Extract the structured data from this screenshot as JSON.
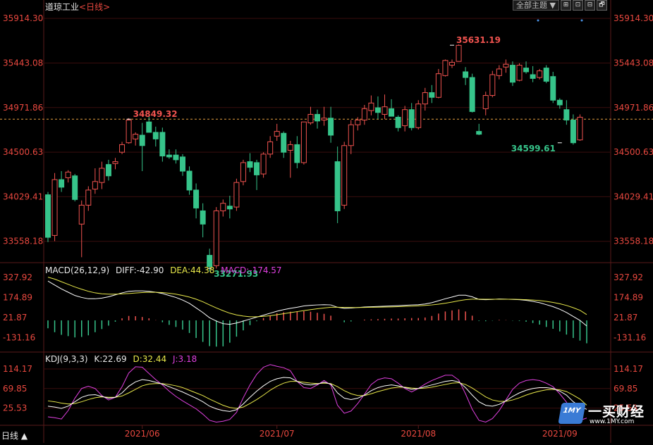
{
  "header": {
    "title": "道琼工业",
    "period": "<日线>"
  },
  "toolbar": {
    "theme_select": "全部主题",
    "theme_arrow": "▼",
    "btn1": "⊞",
    "btn2": "⊡",
    "btn3": "⊟",
    "btn4": "🗗"
  },
  "bottom_tab": "日线 ▲",
  "watermark": {
    "brand": "一买财经",
    "url": "www.1MY.com",
    "mark": "1MY"
  },
  "colors": {
    "up": "#f0534f",
    "down": "#36c48a",
    "bg": "#000000",
    "grid": "#3a0d0d",
    "axis_text": "#e9483f",
    "diff": "#ffffff",
    "dea": "#e8e84a",
    "macd_title": "#e040e0",
    "k": "#ffffff",
    "d": "#e8e84a",
    "j": "#e040e0",
    "ref": "#e6a040"
  },
  "chart_data": [
    {
      "type": "candlestick",
      "name": "price",
      "y_ticks": [
        "35914.30",
        "35443.08",
        "34971.86",
        "34500.63",
        "34029.41",
        "33558.18"
      ],
      "ylim": [
        33340,
        35990
      ],
      "reference_line": 34849.32,
      "annotations": [
        {
          "label": "35631.19",
          "value": 35631.19,
          "index": 60,
          "color": "up"
        },
        {
          "label": "34849.32",
          "value": 34849.32,
          "index": 12,
          "color": "up"
        },
        {
          "label": "33271.93",
          "value": 33271.93,
          "index": 24,
          "color": "down"
        },
        {
          "label": "34599.61",
          "value": 34599.61,
          "index": 76,
          "color": "down"
        }
      ],
      "x_labels": [
        {
          "label": "2021/06",
          "index": 14
        },
        {
          "label": "2021/07",
          "index": 34
        },
        {
          "label": "2021/08",
          "index": 55
        },
        {
          "label": "2021/09",
          "index": 76
        }
      ],
      "ohlc": [
        [
          34050,
          34080,
          33550,
          33600
        ],
        [
          33620,
          34280,
          33560,
          34210
        ],
        [
          34210,
          34300,
          34080,
          34130
        ],
        [
          34230,
          34310,
          34180,
          34290
        ],
        [
          34250,
          34270,
          33980,
          34000
        ],
        [
          33740,
          33990,
          33390,
          33940
        ],
        [
          33940,
          34140,
          33880,
          34100
        ],
        [
          34110,
          34330,
          34060,
          34190
        ],
        [
          34180,
          34400,
          34110,
          34330
        ],
        [
          34370,
          34420,
          34200,
          34250
        ],
        [
          34380,
          34440,
          34320,
          34400
        ],
        [
          34500,
          34610,
          34480,
          34580
        ],
        [
          34600,
          34860,
          34590,
          34840
        ],
        [
          34640,
          34710,
          34570,
          34690
        ],
        [
          34680,
          34810,
          34300,
          34570
        ],
        [
          34820,
          34890,
          34780,
          34710
        ],
        [
          34710,
          34770,
          34560,
          34640
        ],
        [
          34710,
          34760,
          34400,
          34460
        ],
        [
          34470,
          34530,
          34430,
          34450
        ],
        [
          34470,
          34530,
          34380,
          34420
        ],
        [
          34450,
          34480,
          34250,
          34300
        ],
        [
          34300,
          34350,
          34050,
          34100
        ],
        [
          34100,
          34170,
          33800,
          33910
        ],
        [
          33880,
          33960,
          33600,
          33740
        ],
        [
          33410,
          33480,
          33240,
          33290
        ],
        [
          33300,
          33920,
          33270,
          33880
        ],
        [
          33880,
          34000,
          33820,
          33960
        ],
        [
          33930,
          34040,
          33800,
          33900
        ],
        [
          33920,
          34220,
          33880,
          34180
        ],
        [
          34190,
          34420,
          34150,
          34390
        ],
        [
          34400,
          34490,
          34290,
          34340
        ],
        [
          34390,
          34420,
          34100,
          34260
        ],
        [
          34270,
          34500,
          34230,
          34480
        ],
        [
          34480,
          34670,
          34440,
          34610
        ],
        [
          34670,
          34800,
          34620,
          34720
        ],
        [
          34700,
          34720,
          34440,
          34500
        ],
        [
          34520,
          34620,
          34230,
          34580
        ],
        [
          34580,
          34670,
          34330,
          34390
        ],
        [
          34390,
          34810,
          34370,
          34820
        ],
        [
          34810,
          34980,
          34790,
          34900
        ],
        [
          34900,
          34950,
          34750,
          34830
        ],
        [
          34840,
          34980,
          34780,
          34860
        ],
        [
          34860,
          34980,
          34600,
          34680
        ],
        [
          34400,
          34560,
          33750,
          33880
        ],
        [
          33940,
          34610,
          33900,
          34570
        ],
        [
          34570,
          34840,
          34480,
          34790
        ],
        [
          34790,
          34870,
          34730,
          34840
        ],
        [
          34840,
          35000,
          34790,
          34960
        ],
        [
          34940,
          35100,
          34890,
          35020
        ],
        [
          34970,
          35090,
          34850,
          34920
        ],
        [
          34900,
          35110,
          34850,
          34980
        ],
        [
          34960,
          35060,
          34880,
          34880
        ],
        [
          34870,
          34890,
          34720,
          34760
        ],
        [
          34780,
          34990,
          34720,
          34950
        ],
        [
          34950,
          35020,
          34730,
          34760
        ],
        [
          34760,
          35050,
          34740,
          35010
        ],
        [
          35010,
          35180,
          34940,
          35130
        ],
        [
          35130,
          35210,
          35020,
          35080
        ],
        [
          35080,
          35380,
          35070,
          35330
        ],
        [
          35310,
          35480,
          35300,
          35470
        ],
        [
          35420,
          35480,
          35390,
          35450
        ],
        [
          35460,
          35640,
          35460,
          35630
        ],
        [
          35350,
          35400,
          35210,
          35290
        ],
        [
          35290,
          35330,
          34920,
          34930
        ],
        [
          34720,
          34800,
          34680,
          34690
        ],
        [
          34960,
          35140,
          34890,
          35100
        ],
        [
          35100,
          35360,
          35080,
          35320
        ],
        [
          35310,
          35420,
          35270,
          35380
        ],
        [
          35400,
          35480,
          35340,
          35430
        ],
        [
          35420,
          35460,
          35200,
          35240
        ],
        [
          35260,
          35440,
          35250,
          35420
        ],
        [
          35390,
          35460,
          35330,
          35350
        ],
        [
          35320,
          35410,
          35240,
          35280
        ],
        [
          35290,
          35380,
          35270,
          35360
        ],
        [
          35390,
          35420,
          35230,
          35250
        ],
        [
          35300,
          35350,
          35020,
          35050
        ],
        [
          35050,
          35070,
          34960,
          35000
        ],
        [
          34950,
          35050,
          34790,
          34840
        ],
        [
          34840,
          34900,
          34580,
          34600
        ],
        [
          34630,
          34900,
          34620,
          34870
        ]
      ]
    },
    {
      "type": "line+bar",
      "name": "MACD",
      "title": "MACD(26,12,9)",
      "legend": [
        {
          "label": "DIFF:-42.90",
          "color": "diff"
        },
        {
          "label": "DEA:44.38",
          "color": "dea"
        },
        {
          "label": "MACD:-174.57",
          "color": "macd_title"
        }
      ],
      "y_ticks": [
        "327.92",
        "174.89",
        "21.87",
        "-131.16"
      ],
      "ylim": [
        -220,
        360
      ],
      "diff": [
        300,
        270,
        240,
        215,
        190,
        175,
        165,
        165,
        170,
        180,
        195,
        210,
        222,
        225,
        225,
        222,
        215,
        205,
        190,
        175,
        155,
        130,
        95,
        60,
        20,
        -5,
        -25,
        -30,
        -20,
        -5,
        10,
        25,
        40,
        55,
        70,
        82,
        92,
        100,
        110,
        115,
        118,
        120,
        118,
        100,
        92,
        94,
        98,
        102,
        104,
        106,
        108,
        110,
        112,
        115,
        118,
        120,
        125,
        135,
        150,
        165,
        178,
        192,
        192,
        180,
        160,
        158,
        160,
        163,
        162,
        160,
        158,
        153,
        145,
        135,
        120,
        105,
        85,
        60,
        30,
        0,
        -42.9
      ],
      "dea": [
        330,
        315,
        295,
        275,
        255,
        238,
        222,
        210,
        203,
        200,
        200,
        202,
        205,
        209,
        212,
        214,
        214,
        212,
        207,
        200,
        190,
        178,
        162,
        142,
        118,
        95,
        74,
        55,
        42,
        33,
        28,
        28,
        31,
        36,
        43,
        51,
        59,
        67,
        75,
        82,
        89,
        95,
        100,
        100,
        99,
        98,
        98,
        99,
        100,
        101,
        102,
        103,
        105,
        107,
        109,
        111,
        114,
        118,
        124,
        131,
        140,
        150,
        158,
        162,
        162,
        161,
        161,
        161,
        161,
        161,
        160,
        158,
        155,
        151,
        145,
        137,
        127,
        114,
        97,
        77,
        44.38
      ],
      "macd": [
        -60,
        -90,
        -110,
        -120,
        -130,
        -126,
        -114,
        -90,
        -66,
        -40,
        -10,
        16,
        34,
        32,
        26,
        16,
        2,
        -14,
        -34,
        -50,
        -70,
        -96,
        -134,
        -164,
        -196,
        -200,
        -198,
        -170,
        -124,
        -76,
        -36,
        -6,
        18,
        38,
        54,
        62,
        66,
        66,
        70,
        66,
        58,
        50,
        36,
        0,
        -14,
        -8,
        0,
        6,
        8,
        10,
        12,
        14,
        14,
        16,
        18,
        18,
        22,
        34,
        52,
        68,
        76,
        84,
        68,
        36,
        -4,
        -6,
        -2,
        4,
        2,
        -2,
        -4,
        -10,
        -20,
        -32,
        -50,
        -64,
        -84,
        -108,
        -134,
        -154,
        -174.57
      ]
    },
    {
      "type": "line",
      "name": "KDJ",
      "title": "KDJ(9,3,3)",
      "legend": [
        {
          "label": "K:22.69",
          "color": "k"
        },
        {
          "label": "D:32.44",
          "color": "d"
        },
        {
          "label": "J:3.18",
          "color": "j"
        }
      ],
      "y_ticks": [
        "114.17",
        "69.85",
        "25.53"
      ],
      "ylim": [
        -10,
        130
      ],
      "k": [
        30,
        28,
        25,
        30,
        40,
        50,
        55,
        56,
        52,
        48,
        50,
        60,
        75,
        85,
        90,
        88,
        84,
        80,
        74,
        68,
        62,
        55,
        48,
        40,
        30,
        24,
        20,
        18,
        22,
        35,
        50,
        64,
        76,
        86,
        92,
        95,
        94,
        86,
        80,
        78,
        80,
        84,
        80,
        60,
        48,
        45,
        48,
        55,
        65,
        72,
        76,
        78,
        76,
        72,
        68,
        70,
        74,
        78,
        82,
        86,
        88,
        85,
        72,
        55,
        40,
        32,
        30,
        34,
        42,
        52,
        60,
        66,
        70,
        72,
        72,
        70,
        64,
        55,
        40,
        30,
        22.69
      ],
      "d": [
        42,
        40,
        37,
        35,
        36,
        40,
        45,
        49,
        51,
        50,
        50,
        53,
        60,
        68,
        76,
        80,
        81,
        81,
        79,
        76,
        72,
        66,
        60,
        54,
        46,
        39,
        32,
        27,
        25,
        28,
        36,
        45,
        55,
        66,
        75,
        82,
        86,
        86,
        84,
        82,
        81,
        82,
        81,
        74,
        65,
        58,
        54,
        54,
        58,
        63,
        67,
        71,
        73,
        73,
        71,
        70,
        71,
        73,
        76,
        79,
        82,
        83,
        79,
        71,
        61,
        51,
        44,
        41,
        41,
        44,
        49,
        55,
        60,
        64,
        67,
        68,
        67,
        63,
        55,
        46,
        32.44
      ],
      "j": [
        6,
        4,
        1,
        20,
        48,
        70,
        75,
        70,
        54,
        44,
        50,
        74,
        105,
        119,
        118,
        104,
        90,
        78,
        64,
        52,
        42,
        33,
        24,
        12,
        -2,
        -6,
        -4,
        0,
        16,
        49,
        78,
        102,
        118,
        124,
        120,
        117,
        110,
        86,
        72,
        70,
        78,
        88,
        78,
        32,
        14,
        19,
        36,
        57,
        79,
        90,
        94,
        92,
        82,
        70,
        62,
        70,
        80,
        88,
        94,
        100,
        100,
        89,
        58,
        23,
        -2,
        -6,
        2,
        20,
        44,
        68,
        82,
        88,
        90,
        88,
        82,
        74,
        58,
        39,
        10,
        -2,
        3.18
      ]
    }
  ]
}
